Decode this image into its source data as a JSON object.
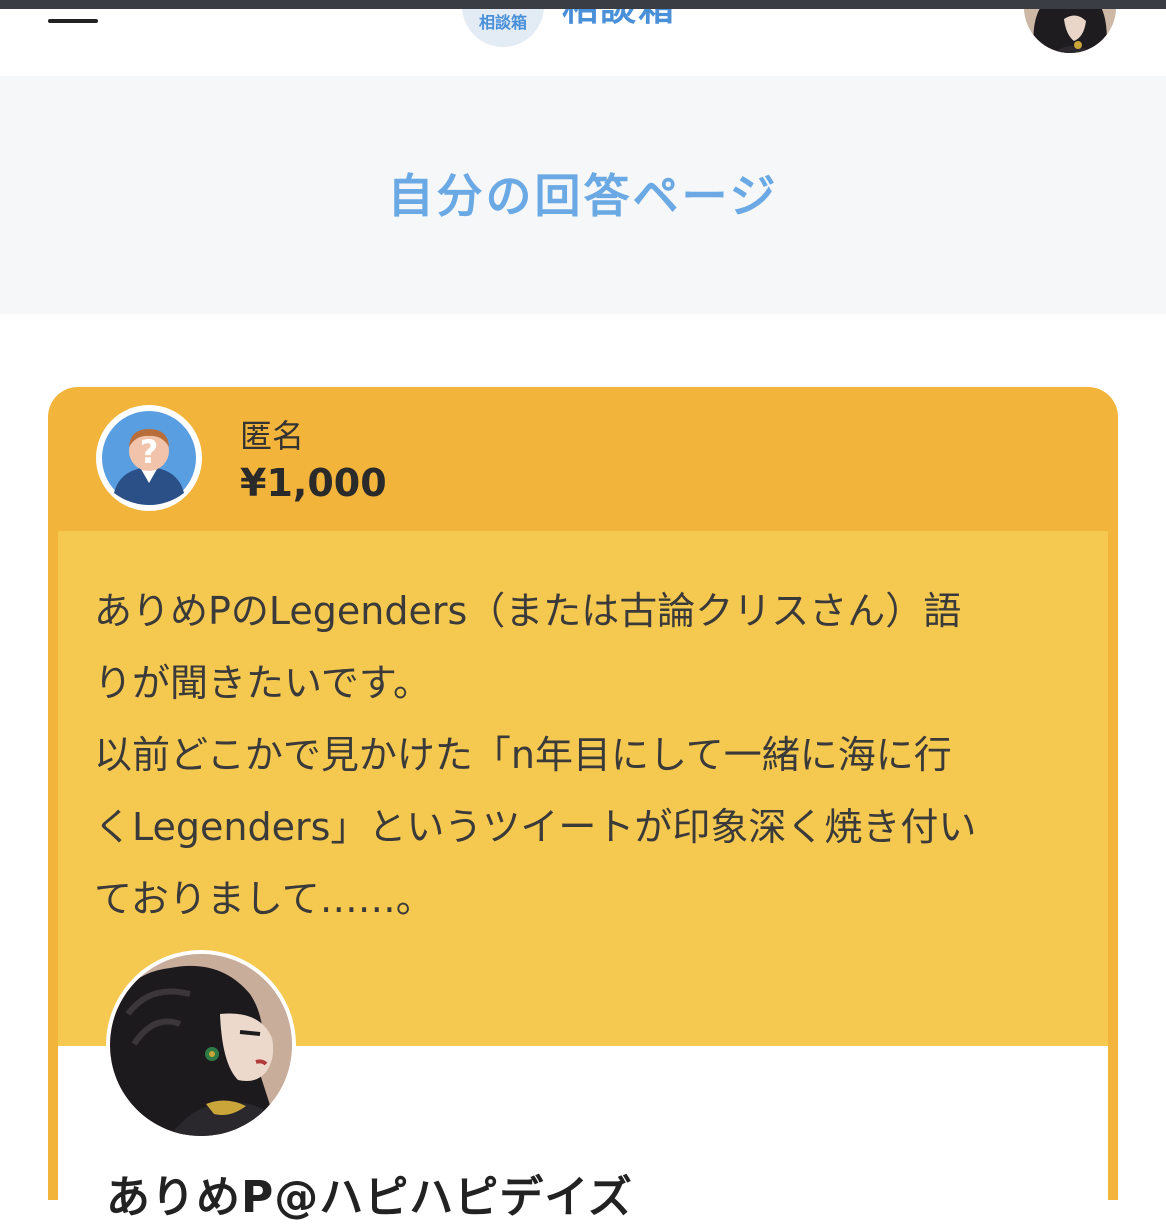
{
  "header": {
    "menu_icon": "hamburger-menu-icon",
    "logo_badge": "相談箱",
    "logo_text": "相談箱",
    "user_avatar_icon": "user-avatar"
  },
  "page": {
    "title": "自分の回答ページ"
  },
  "question_card": {
    "asker_name": "匿名",
    "amount": "¥1,000",
    "anon_icon": "anonymous-user-icon",
    "body_lines": [
      "ありめPのLegenders（または古論クリスさん）語",
      "りが聞きたいです。",
      "以前どこかで見かけた「n年目にして一緒に海に行",
      "くLegenders」というツイートが印象深く焼き付い",
      "ておりまして……。"
    ]
  },
  "answer": {
    "answerer_name": "ありめP@ハピハピデイズ"
  },
  "colors": {
    "accent_blue": "#6aa9e4",
    "card_orange": "#f2b43b",
    "card_yellow": "#f5c84f"
  }
}
